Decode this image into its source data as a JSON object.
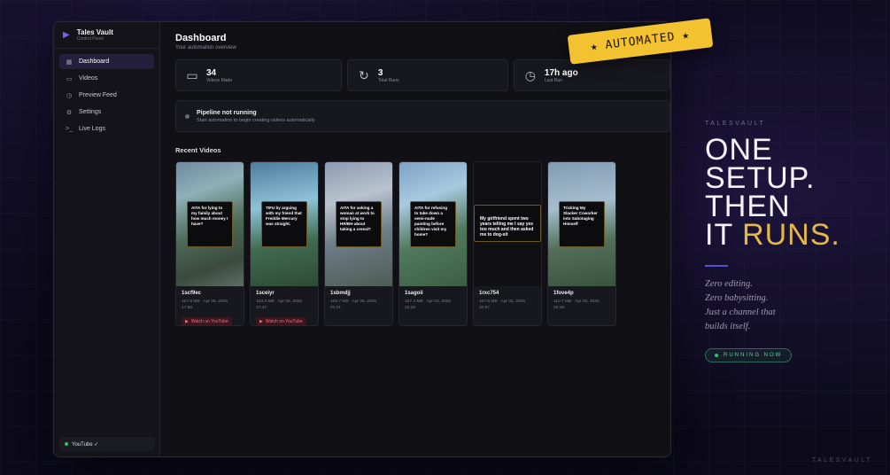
{
  "app": {
    "brand_title": "Tales Vault",
    "brand_subtitle": "Control Panel",
    "youtube_status": "YouTube ✓"
  },
  "sidebar": {
    "items": [
      {
        "label": "Dashboard",
        "icon": "grid-icon",
        "active": true
      },
      {
        "label": "Videos",
        "icon": "video-icon",
        "active": false
      },
      {
        "label": "Preview Feed",
        "icon": "clock-icon",
        "active": false
      },
      {
        "label": "Settings",
        "icon": "gear-icon",
        "active": false
      },
      {
        "label": "Live Logs",
        "icon": "terminal-icon",
        "active": false
      }
    ]
  },
  "header": {
    "title": "Dashboard",
    "subtitle": "Your automation overview"
  },
  "stats": [
    {
      "value": "34",
      "label": "Videos Made",
      "icon": "video-icon"
    },
    {
      "value": "3",
      "label": "Total Runs",
      "icon": "refresh-icon"
    },
    {
      "value": "17h ago",
      "label": "Last Run",
      "icon": "clock-icon"
    }
  ],
  "pipeline": {
    "title": "Pipeline not running",
    "subtitle": "Start automation to begin creating videos automatically"
  },
  "recent_videos": {
    "title": "Recent Videos",
    "watch_label": "Watch on YouTube",
    "items": [
      {
        "id": "1scf9ec",
        "meta": "107.9 MB · Apr 05, 2026",
        "time": "17:58",
        "caption": "AITA for lying to my family about how much money I have?",
        "youtube": true
      },
      {
        "id": "1sceiyr",
        "meta": "103.3 MB · Apr 05, 2026",
        "time": "17:47",
        "caption": "TIFU by arguing with my friend that Freddie Mercury was straight.",
        "youtube": true
      },
      {
        "id": "1sbmdjj",
        "meta": "105.7 MB · Apr 05, 2026",
        "time": "01:21",
        "caption": "AITA for asking a woman at work to stop lying to HR/BH about taking a cereal?",
        "youtube": false
      },
      {
        "id": "1sagoii",
        "meta": "107.2 MB · Apr 03, 2026",
        "time": "21:25",
        "caption": "AITA for refusing to take down a semi-nude painting before children visit my home?",
        "youtube": false
      },
      {
        "id": "1rxc754",
        "meta": "107.6 MB · Apr 02, 2026",
        "time": "20:57",
        "caption": "My girlfriend spent two years telling me I say yes too much and then asked me to dog-sit",
        "youtube": false
      },
      {
        "id": "1fove4p",
        "meta": "110.7 MB · Apr 02, 2026",
        "time": "20:48",
        "caption": "Tricking My Slacker Coworker into Sabotaging Himself",
        "youtube": false
      }
    ]
  },
  "badge": {
    "text": "AUTOMATED",
    "star": "★"
  },
  "promo": {
    "eyebrow": "TALESVAULT",
    "line1": "ONE",
    "line2": "SETUP.",
    "line3": "THEN",
    "line4a": "IT",
    "line4b": "RUNS.",
    "tagline1": "Zero editing.",
    "tagline2": "Zero babysitting.",
    "tagline3": "Just a channel that",
    "tagline4": "builds itself.",
    "running": "RUNNING NOW",
    "footer": "TALESVAULT"
  },
  "colors": {
    "accent": "#7b5cf0",
    "gold": "#e3b844",
    "badge": "#f2c230",
    "green": "#30c26a"
  }
}
